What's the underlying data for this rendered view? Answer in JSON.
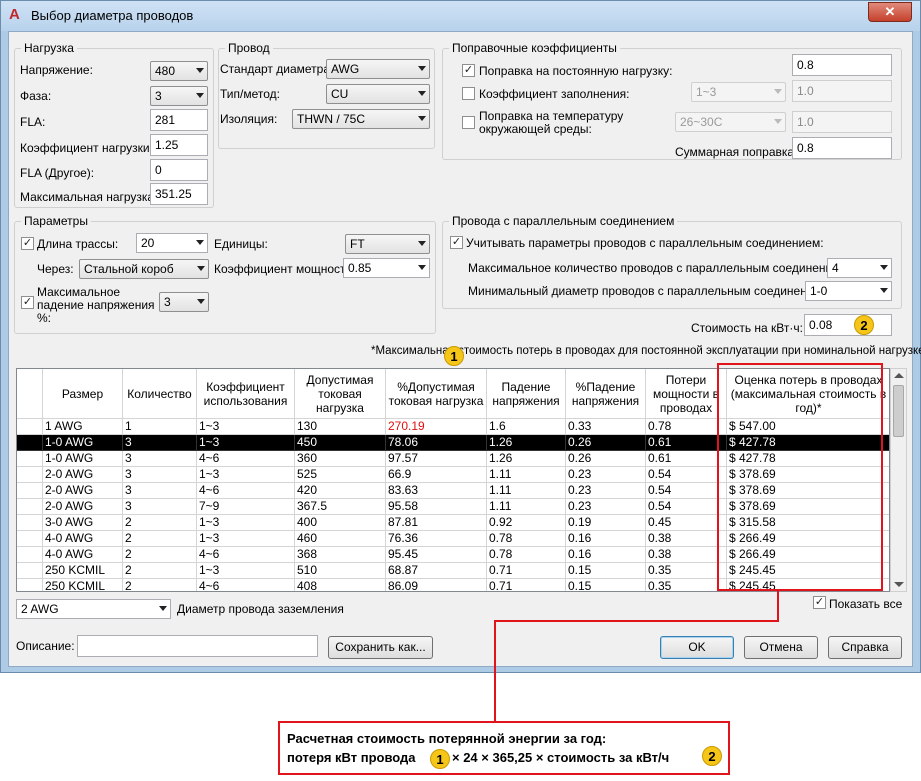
{
  "window": {
    "title": "Выбор диаметра проводов",
    "close_glyph": "✕",
    "app_icon": "autocad-icon"
  },
  "load": {
    "title": "Нагрузка",
    "voltage_label": "Напряжение:",
    "voltage": "480",
    "phase_label": "Фаза:",
    "phase": "3",
    "fla_label": "FLA:",
    "fla": "281",
    "load_factor_label": "Коэффициент нагрузки:",
    "load_factor": "1.25",
    "fla_other_label": "FLA (Другое):",
    "fla_other": "0",
    "max_load_label": "Максимальная нагрузка:",
    "max_load": "351.25"
  },
  "wire": {
    "title": "Провод",
    "standard_label": "Стандарт диаметра:",
    "standard": "AWG",
    "type_label": "Тип/метод:",
    "type": "CU",
    "insulation_label": "Изоляция:",
    "insulation": "THWN / 75C"
  },
  "correction": {
    "title": "Поправочные коэффициенты",
    "continuous_label": "Поправка на постоянную нагрузку:",
    "continuous_checked": "✓",
    "continuous_value": "0.8",
    "fill_label": "Коэффициент заполнения:",
    "fill_combo": "1~3",
    "fill_value": "1.0",
    "temp_label_1": "Поправка на температуру",
    "temp_label_2": "окружающей среды:",
    "temp_combo": "26~30C",
    "temp_value": "1.0",
    "total_label": "Суммарная поправка:",
    "total_value": "0.8"
  },
  "params": {
    "title": "Параметры",
    "run_length_label": "Длина трассы:",
    "run_length_checked": "✓",
    "run_length": "20",
    "units_label": "Единицы:",
    "units": "FT",
    "via_label": "Через:",
    "via": "Стальной короб",
    "power_factor_label": "Коэффициент мощности:",
    "power_factor": "0.85",
    "vdrop_label_1": "Максимальное",
    "vdrop_label_2": "падение напряжения",
    "vdrop_label_3": "%:",
    "vdrop_checked": "✓",
    "vdrop": "3"
  },
  "parallel": {
    "title": "Провода с параллельным соединением",
    "consider_label": "Учитывать параметры проводов с параллельным соединением:",
    "consider_checked": "✓",
    "max_count_label": "Максимальное количество проводов с параллельным соединением:",
    "max_count": "4",
    "min_size_label": "Минимальный диаметр проводов с параллельным соединением:",
    "min_size": "1-0"
  },
  "cost": {
    "label": "Стоимость на кВт·ч:",
    "value": "0.08"
  },
  "note": "*Максимальная стоимость потерь в проводах для постоянной эксплуатации при номинальной нагрузке",
  "grid": {
    "headers": [
      "Размер",
      "Количество",
      "Коэффициент использования",
      "Допустимая токовая нагрузка",
      "%Допустимая токовая нагрузка",
      "Падение напряжения",
      "%Падение напряжения",
      "Потери мощности в проводах",
      "Оценка потерь в проводах (максимальная стоимость в год)*"
    ],
    "rows": [
      [
        "1 AWG",
        "1",
        "1~3",
        "130",
        "270.19",
        "1.6",
        "0.33",
        "0.78",
        "$ 547.00"
      ],
      [
        "1-0 AWG",
        "3",
        "1~3",
        "450",
        "78.06",
        "1.26",
        "0.26",
        "0.61",
        "$ 427.78"
      ],
      [
        "1-0 AWG",
        "3",
        "4~6",
        "360",
        "97.57",
        "1.26",
        "0.26",
        "0.61",
        "$ 427.78"
      ],
      [
        "2-0 AWG",
        "3",
        "1~3",
        "525",
        "66.9",
        "1.11",
        "0.23",
        "0.54",
        "$ 378.69"
      ],
      [
        "2-0 AWG",
        "3",
        "4~6",
        "420",
        "83.63",
        "1.11",
        "0.23",
        "0.54",
        "$ 378.69"
      ],
      [
        "2-0 AWG",
        "3",
        "7~9",
        "367.5",
        "95.58",
        "1.11",
        "0.23",
        "0.54",
        "$ 378.69"
      ],
      [
        "3-0 AWG",
        "2",
        "1~3",
        "400",
        "87.81",
        "0.92",
        "0.19",
        "0.45",
        "$ 315.58"
      ],
      [
        "4-0 AWG",
        "2",
        "1~3",
        "460",
        "76.36",
        "0.78",
        "0.16",
        "0.38",
        "$ 266.49"
      ],
      [
        "4-0 AWG",
        "2",
        "4~6",
        "368",
        "95.45",
        "0.78",
        "0.16",
        "0.38",
        "$ 266.49"
      ],
      [
        "250 KCMIL",
        "2",
        "1~3",
        "510",
        "68.87",
        "0.71",
        "0.15",
        "0.35",
        "$ 245.45"
      ],
      [
        "250 KCMIL",
        "2",
        "4~6",
        "408",
        "86.09",
        "0.71",
        "0.15",
        "0.35",
        "$ 245.45"
      ]
    ],
    "selected_row": 1,
    "overload_color": "#e01010"
  },
  "ground": {
    "value": "2 AWG",
    "label": "Диаметр провода заземления"
  },
  "show_all": {
    "label": "Показать все",
    "checked": "✓"
  },
  "description": {
    "label": "Описание:",
    "value": ""
  },
  "buttons": {
    "save_as": "Сохранить как...",
    "ok": "OK",
    "cancel": "Отмена",
    "help": "Справка"
  },
  "callouts": {
    "one": "1",
    "two": "2"
  },
  "formula": {
    "line1": "Расчетная стоимость потерянной энергии за год:",
    "line2_a": "потеря кВт провода",
    "line2_b": "× 24 × 365,25 × стоимость за кВт/ч"
  },
  "accent_color": "#e0141a"
}
